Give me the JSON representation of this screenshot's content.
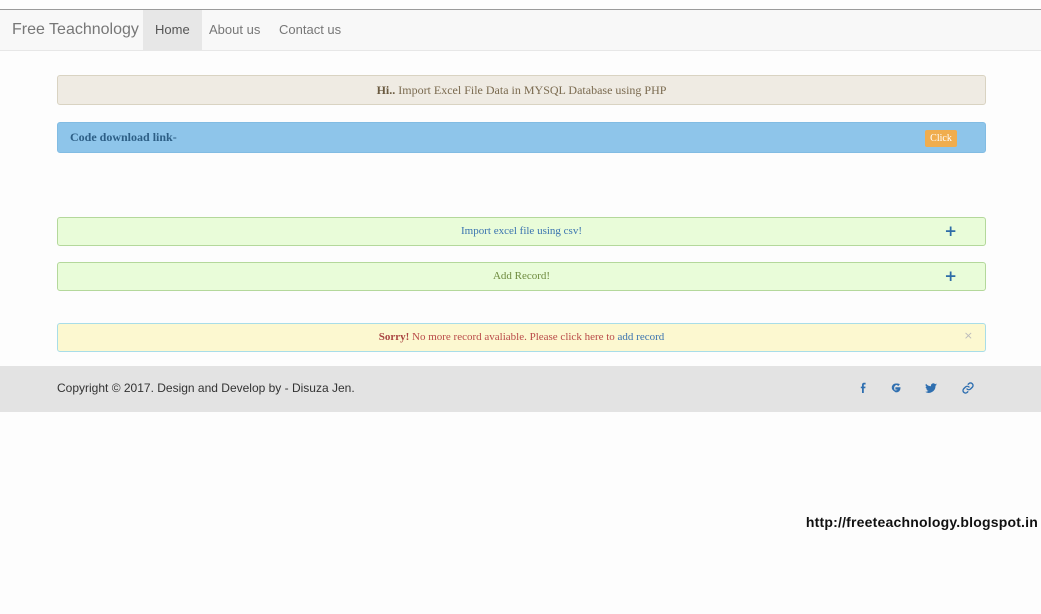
{
  "navbar": {
    "brand": "Free Teachnology",
    "items": [
      {
        "label": "Home",
        "active": true
      },
      {
        "label": "About us",
        "active": false
      },
      {
        "label": "Contact us",
        "active": false
      }
    ]
  },
  "hi_panel": {
    "bold": "Hi..",
    "text": " Import Excel File Data in MYSQL Database using PHP"
  },
  "download_panel": {
    "label": "Code download link-",
    "button": "Click"
  },
  "import_panel": {
    "label": "Import excel file using csv!",
    "icon": "plus-icon"
  },
  "add_panel": {
    "label": "Add Record!",
    "icon": "plus-icon"
  },
  "alert": {
    "bold": "Sorry!",
    "text": " No more record avaliable. Please click here to ",
    "link": "add record",
    "close": "×"
  },
  "footer": {
    "copyright": "Copyright © 2017. Design and Develop by - Disuza Jen.",
    "social": [
      {
        "icon": "facebook-icon",
        "glyph": "f"
      },
      {
        "icon": "google-plus-icon",
        "glyph": "g"
      },
      {
        "icon": "twitter-icon",
        "glyph": "t"
      },
      {
        "icon": "link-icon",
        "glyph": "link"
      }
    ]
  },
  "watermark": "http://freeteachnology.blogspot.in",
  "colors": {
    "download_panel_bg": "#8ec5ea",
    "click_button_bg": "#f0ad4e",
    "collapse_panel_bg": "#e9fcd9",
    "alert_bg": "#fcf8d0",
    "footer_bg": "#e3e3e3"
  }
}
